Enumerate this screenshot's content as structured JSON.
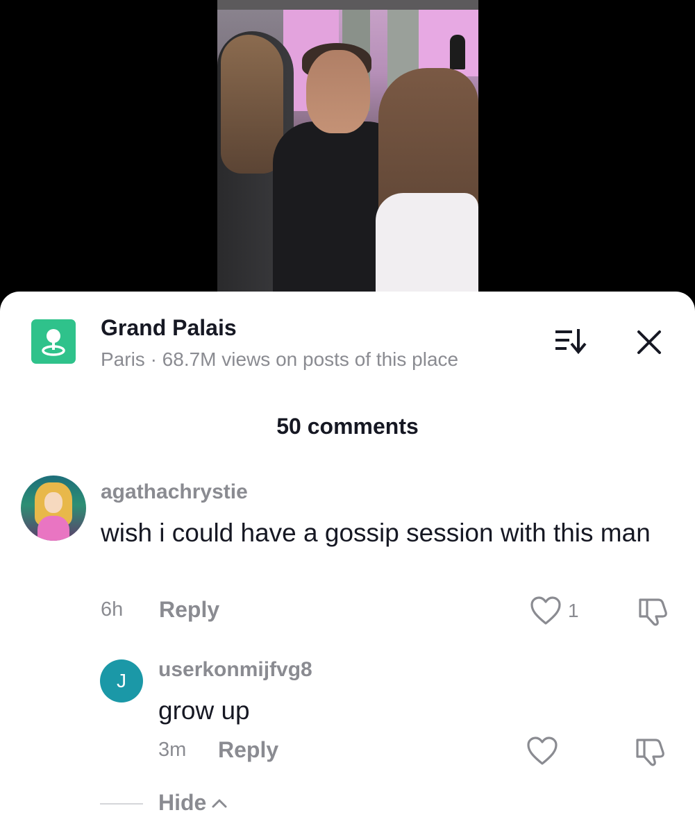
{
  "place": {
    "title": "Grand Palais",
    "subtitle": "Paris · 68.7M views on posts of this place",
    "accent_color": "#2fc28b",
    "icon": "location-pin-icon"
  },
  "header": {
    "sort_icon": "sort-icon",
    "close_icon": "close-icon"
  },
  "comments": {
    "count_label": "50 comments",
    "items": [
      {
        "username": "agathachrystie",
        "text": "wish i could have a gossip session with this man",
        "time": "6h",
        "reply_label": "Reply",
        "likes": "1"
      }
    ],
    "replies": [
      {
        "username": "userkonmijfvg8",
        "avatar_letter": "J",
        "text": "grow up",
        "time": "3m",
        "reply_label": "Reply"
      }
    ],
    "hide_label": "Hide"
  }
}
